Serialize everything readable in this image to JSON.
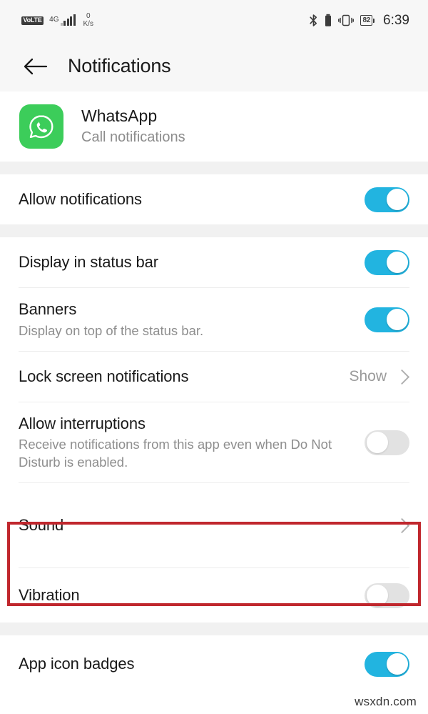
{
  "status_bar": {
    "volte_label": "VoLTE",
    "network_type": "4G",
    "signal_bars": 5,
    "net_speed_value": "0",
    "net_speed_unit": "K/s",
    "bluetooth_icon": "bluetooth-icon",
    "bt_battery_icon": "bluetooth-device-battery-icon",
    "vibrate_icon": "vibrate-mode-icon",
    "battery_percent": "82",
    "time": "6:39"
  },
  "app_bar": {
    "back_icon": "back-arrow-icon",
    "title": "Notifications"
  },
  "app_header": {
    "icon": "whatsapp-icon",
    "icon_color": "#3ccd5a",
    "name": "WhatsApp",
    "subtitle": "Call notifications"
  },
  "settings": {
    "allow_notifications": {
      "label": "Allow notifications",
      "state": "on"
    },
    "display_in_status_bar": {
      "label": "Display in status bar",
      "state": "on"
    },
    "banners": {
      "label": "Banners",
      "description": "Display on top of the status bar.",
      "state": "on"
    },
    "lock_screen_notifications": {
      "label": "Lock screen notifications",
      "value": "Show"
    },
    "allow_interruptions": {
      "label": "Allow interruptions",
      "description": "Receive notifications from this app even when Do Not Disturb is enabled.",
      "state": "off"
    },
    "sound": {
      "label": "Sound",
      "highlighted": true,
      "highlight_color": "#c0272d"
    },
    "vibration": {
      "label": "Vibration",
      "state": "off"
    },
    "app_icon_badges": {
      "label": "App icon badges",
      "state": "on"
    }
  },
  "accent_color": "#22b4e0",
  "watermark": "wsxdn.com"
}
